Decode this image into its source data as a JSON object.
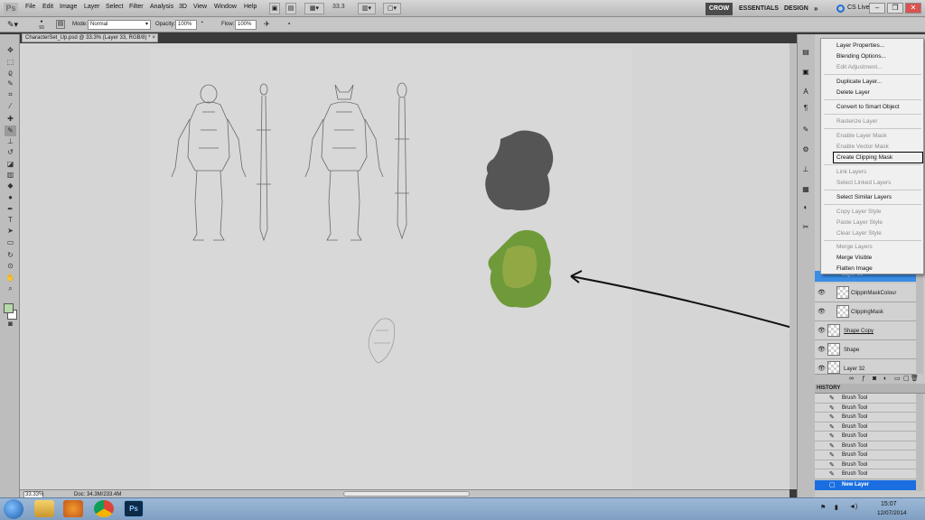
{
  "menubar": {
    "logo": "Ps",
    "items": [
      "File",
      "Edit",
      "Image",
      "Layer",
      "Select",
      "Filter",
      "Analysis",
      "3D",
      "View",
      "Window",
      "Help"
    ],
    "zoom": "33.3",
    "workspaces": [
      "CROW",
      "ESSENTIALS",
      "DESIGN"
    ],
    "more": "»",
    "cs_live": "CS Live",
    "window_buttons": [
      "–",
      "❐",
      "✕"
    ]
  },
  "options": {
    "mode_label": "Mode:",
    "mode_value": "Normal",
    "opacity_label": "Opacity:",
    "opacity_value": "100%",
    "flow_label": "Flow:",
    "flow_value": "100%",
    "brush_size": "93"
  },
  "document": {
    "tab_title": "CharacterSet_Up.psd @ 33.3% (Layer 33, RGB/8) *",
    "tab_close": "×"
  },
  "status": {
    "zoom": "33.33%",
    "doc_size": "Doc: 34.3M/233.4M"
  },
  "colors": {
    "foreground": "#b7d8a8",
    "background": "#ffffff",
    "selection": "#3a8ee6"
  },
  "layers": {
    "partial_top": "Layer 33",
    "rows": [
      {
        "name": "ClippinMaskColour"
      },
      {
        "name": "ClippingMask"
      },
      {
        "name": "Shape Copy"
      },
      {
        "name": "Shape"
      },
      {
        "name": "Layer 32"
      }
    ]
  },
  "history": {
    "title": "HISTORY",
    "items": [
      "Brush Tool",
      "Brush Tool",
      "Brush Tool",
      "Brush Tool",
      "Brush Tool",
      "Brush Tool",
      "Brush Tool",
      "Brush Tool",
      "Brush Tool"
    ],
    "selected": "New Layer"
  },
  "context_menu": {
    "groups": [
      [
        {
          "label": "Layer Properties...",
          "enabled": true
        },
        {
          "label": "Blending Options...",
          "enabled": true
        },
        {
          "label": "Edit Adjustment...",
          "enabled": false
        }
      ],
      [
        {
          "label": "Duplicate Layer...",
          "enabled": true
        },
        {
          "label": "Delete Layer",
          "enabled": true
        }
      ],
      [
        {
          "label": "Convert to Smart Object",
          "enabled": true
        }
      ],
      [
        {
          "label": "Rasterize Layer",
          "enabled": false
        }
      ],
      [
        {
          "label": "Enable Layer Mask",
          "enabled": false
        },
        {
          "label": "Enable Vector Mask",
          "enabled": false
        },
        {
          "label": "Create Clipping Mask",
          "enabled": true
        }
      ],
      [
        {
          "label": "Link Layers",
          "enabled": false
        },
        {
          "label": "Select Linked Layers",
          "enabled": false
        }
      ],
      [
        {
          "label": "Select Similar Layers",
          "enabled": true
        }
      ],
      [
        {
          "label": "Copy Layer Style",
          "enabled": false
        },
        {
          "label": "Paste Layer Style",
          "enabled": false
        },
        {
          "label": "Clear Layer Style",
          "enabled": false
        }
      ],
      [
        {
          "label": "Merge Layers",
          "enabled": false
        },
        {
          "label": "Merge Visible",
          "enabled": true
        },
        {
          "label": "Flatten Image",
          "enabled": true
        }
      ]
    ],
    "highlighted": "Create Clipping Mask"
  },
  "tray": {
    "time": "15:07",
    "date": "12/07/2014"
  },
  "icons": {
    "toolbar": [
      "move-icon",
      "marquee-icon",
      "lasso-icon",
      "quick-select-icon",
      "crop-icon",
      "eyedropper-icon",
      "healing-icon",
      "brush-icon",
      "clone-stamp-icon",
      "history-brush-icon",
      "eraser-icon",
      "gradient-icon",
      "blur-icon",
      "dodge-icon",
      "pen-icon",
      "type-icon",
      "path-select-icon",
      "shape-icon",
      "3d-rotate-icon",
      "3d-camera-icon",
      "hand-icon",
      "zoom-icon"
    ],
    "taskbar": [
      "explorer-icon",
      "media-player-icon",
      "chrome-icon",
      "photoshop-icon"
    ]
  }
}
